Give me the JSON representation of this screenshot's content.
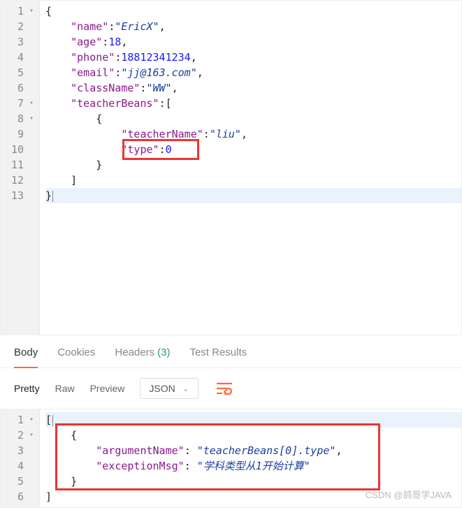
{
  "top_editor": {
    "lines": [
      {
        "num": "1",
        "fold": true
      },
      {
        "num": "2",
        "fold": false
      },
      {
        "num": "3",
        "fold": false
      },
      {
        "num": "4",
        "fold": false
      },
      {
        "num": "5",
        "fold": false
      },
      {
        "num": "6",
        "fold": false
      },
      {
        "num": "7",
        "fold": true
      },
      {
        "num": "8",
        "fold": true
      },
      {
        "num": "9",
        "fold": false
      },
      {
        "num": "10",
        "fold": false
      },
      {
        "num": "11",
        "fold": false
      },
      {
        "num": "12",
        "fold": false
      },
      {
        "num": "13",
        "fold": false
      }
    ],
    "json_body": {
      "name": "EricX",
      "age": 18,
      "phone": 18812341234,
      "email": "jj@163.com",
      "className": "WW",
      "teacherBeans": [
        {
          "teacherName": "liu",
          "type": 0
        }
      ]
    },
    "tokens": {
      "l1_open": "{",
      "l2_key": "\"name\"",
      "l2_val": "\"EricX\"",
      "l3_key": "\"age\"",
      "l3_val": "18",
      "l4_key": "\"phone\"",
      "l4_val": "18812341234",
      "l5_key": "\"email\"",
      "l5_val": "\"jj@163.com\"",
      "l6_key": "\"className\"",
      "l6_val": "\"WW\"",
      "l7_key": "\"teacherBeans\"",
      "l7_open": "[",
      "l8_open": "{",
      "l9_key": "\"teacherName\"",
      "l9_val": "\"liu\"",
      "l10_key": "\"type\"",
      "l10_val": "0",
      "l11_close": "}",
      "l12_close": "]",
      "l13_close": "}"
    },
    "active_line": 13
  },
  "tabs": {
    "items": [
      {
        "label": "Body",
        "active": true
      },
      {
        "label": "Cookies",
        "active": false
      },
      {
        "label": "Headers",
        "active": false,
        "count": "(3)"
      },
      {
        "label": "Test Results",
        "active": false
      }
    ]
  },
  "toolbar": {
    "views": [
      {
        "label": "Pretty",
        "active": true
      },
      {
        "label": "Raw",
        "active": false
      },
      {
        "label": "Preview",
        "active": false
      }
    ],
    "format_select": "JSON"
  },
  "bottom_editor": {
    "lines": [
      {
        "num": "1",
        "fold": true
      },
      {
        "num": "2",
        "fold": true
      },
      {
        "num": "3",
        "fold": false
      },
      {
        "num": "4",
        "fold": false
      },
      {
        "num": "5",
        "fold": false
      },
      {
        "num": "6",
        "fold": false
      }
    ],
    "response_json": [
      {
        "argumentName": "teacherBeans[0].type",
        "exceptionMsg": "学科类型从1开始计算"
      }
    ],
    "tokens": {
      "l1_open": "[",
      "l2_open": "{",
      "l3_key": "\"argumentName\"",
      "l3_val": "\"teacherBeans[0].type\"",
      "l4_key": "\"exceptionMsg\"",
      "l4_val": "\"学科类型从1开始计算\"",
      "l5_close": "}",
      "l6_close": "]"
    }
  },
  "watermark": "CSDN @鸽哥学JAVA"
}
